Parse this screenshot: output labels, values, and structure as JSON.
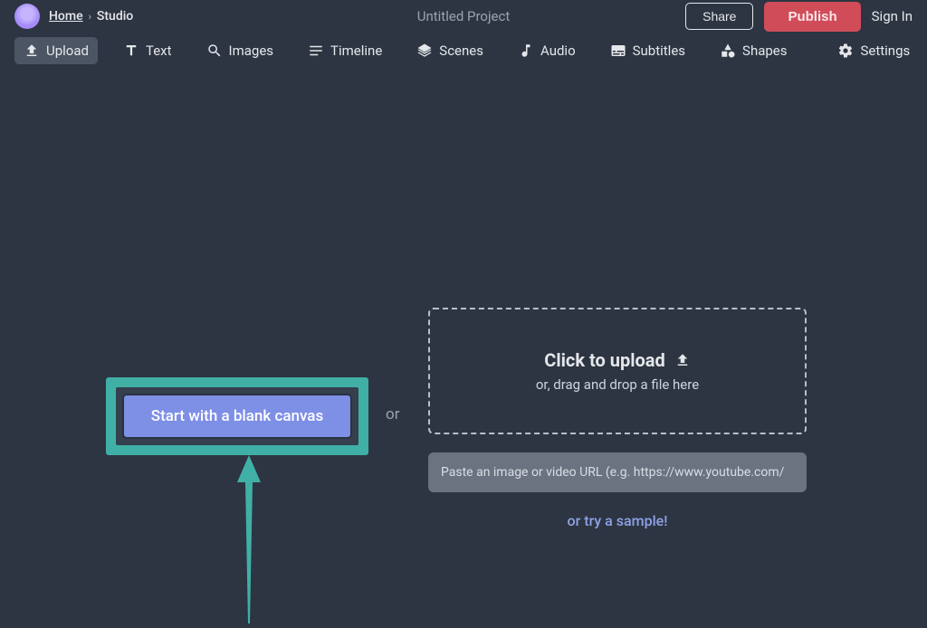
{
  "header": {
    "home": "Home",
    "studio": "Studio",
    "project_title": "Untitled Project",
    "share": "Share",
    "publish": "Publish",
    "signin": "Sign In"
  },
  "toolbar": {
    "upload": "Upload",
    "text": "Text",
    "images": "Images",
    "timeline": "Timeline",
    "scenes": "Scenes",
    "audio": "Audio",
    "subtitles": "Subtitles",
    "shapes": "Shapes",
    "settings": "Settings"
  },
  "main": {
    "start_blank": "Start with a blank canvas",
    "or": "or",
    "upload_main": "Click to upload",
    "upload_sub": "or, drag and drop a file here",
    "url_placeholder": "Paste an image or video URL (e.g. https://www.youtube.com/",
    "try_sample": "or try a sample!"
  }
}
